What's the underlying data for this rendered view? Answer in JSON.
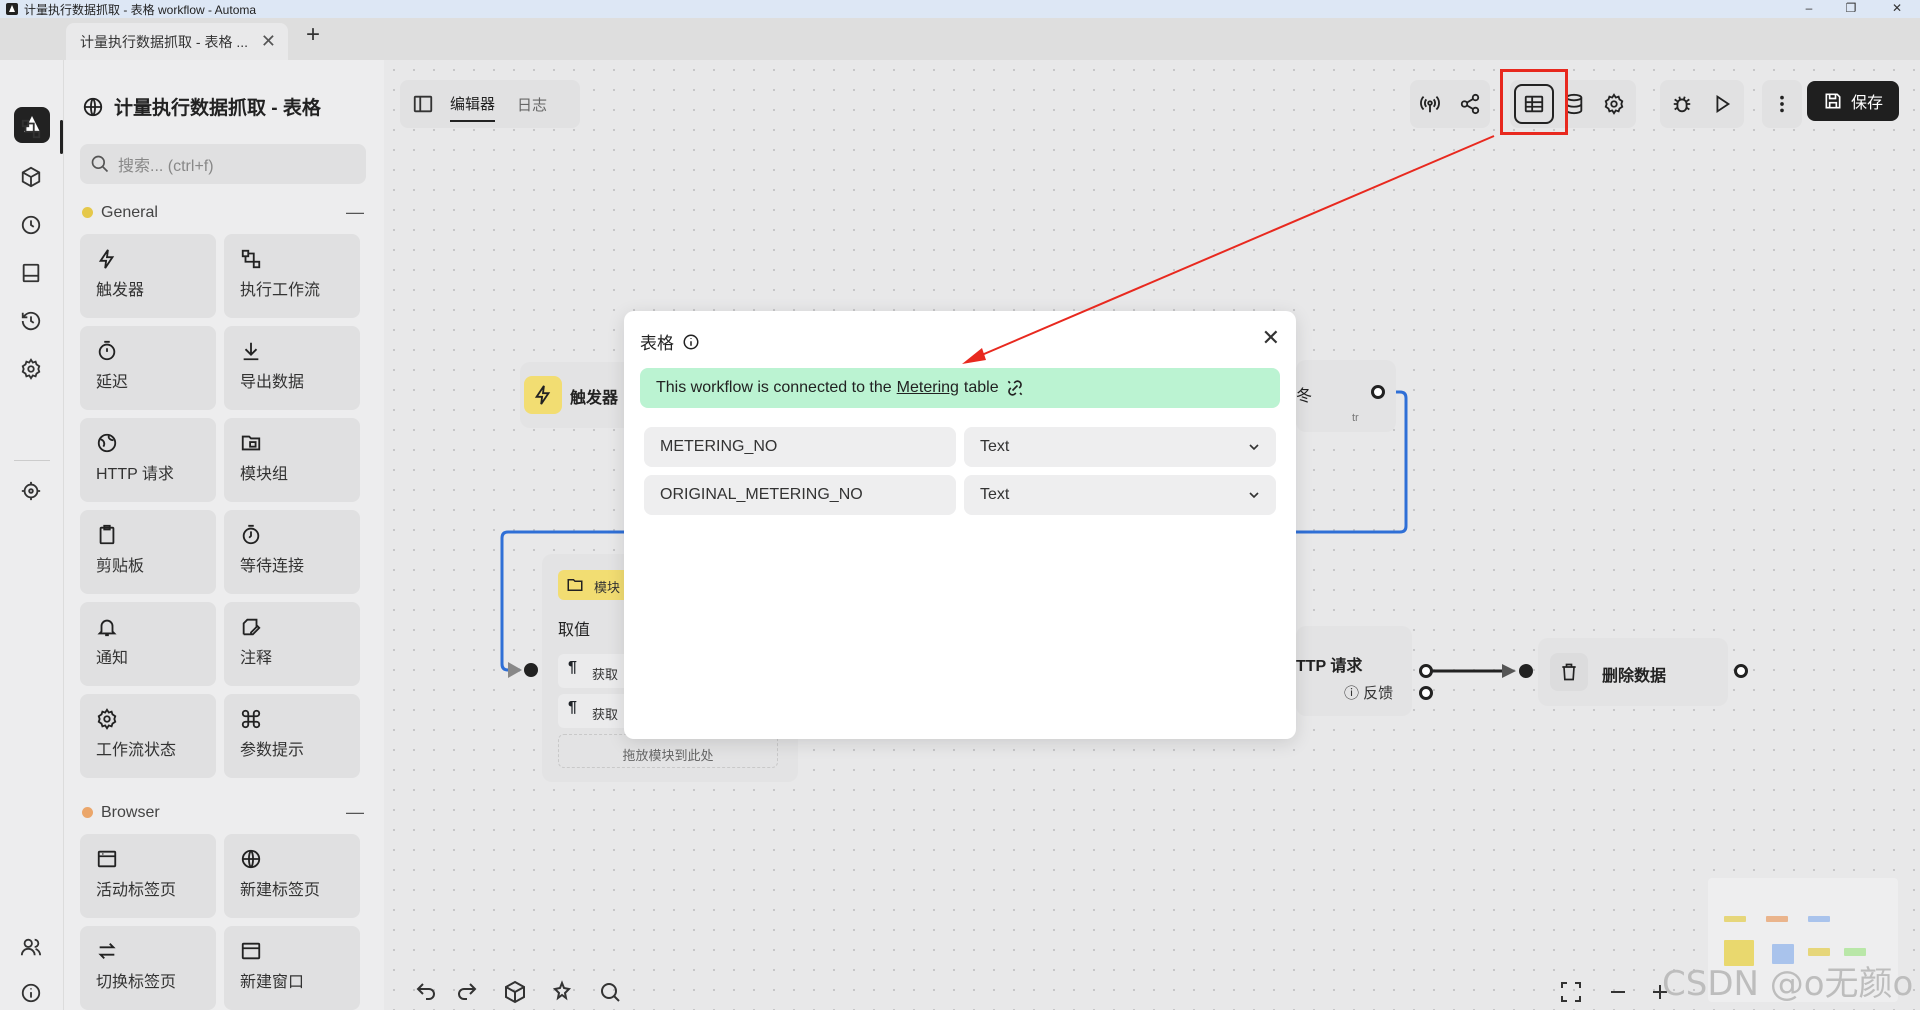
{
  "window": {
    "title": "计量执行数据抓取 - 表格 workflow - Automa",
    "minimize": "–",
    "maximize": "❐",
    "close": "✕"
  },
  "browser_tab": {
    "label": "计量执行数据抓取 - 表格 ...",
    "close": "✕",
    "new_tab": "+"
  },
  "panel": {
    "workflow_title": "计量执行数据抓取 - 表格",
    "search_placeholder": "搜索... (ctrl+f)",
    "groups": [
      {
        "name": "General",
        "color": "#e5c84a",
        "collapse": "—"
      },
      {
        "name": "Browser",
        "color": "#eba66a",
        "collapse": "—"
      }
    ],
    "blocks": [
      {
        "label": "触发器",
        "icon": "lightning-icon"
      },
      {
        "label": "执行工作流",
        "icon": "workflow-icon"
      },
      {
        "label": "延迟",
        "icon": "timer-icon"
      },
      {
        "label": "导出数据",
        "icon": "download-icon"
      },
      {
        "label": "HTTP 请求",
        "icon": "globe-icon"
      },
      {
        "label": "模块组",
        "icon": "folder-icon"
      },
      {
        "label": "剪贴板",
        "icon": "clipboard-icon"
      },
      {
        "label": "等待连接",
        "icon": "stopwatch-icon"
      },
      {
        "label": "通知",
        "icon": "bell-icon"
      },
      {
        "label": "注释",
        "icon": "note-icon"
      },
      {
        "label": "工作流状态",
        "icon": "gear-icon"
      },
      {
        "label": "参数提示",
        "icon": "command-icon"
      },
      {
        "label": "活动标签页",
        "icon": "window-icon"
      },
      {
        "label": "新建标签页",
        "icon": "globe-icon"
      },
      {
        "label": "切换标签页",
        "icon": "swap-icon"
      },
      {
        "label": "新建窗口",
        "icon": "window-icon"
      }
    ]
  },
  "editor": {
    "tabs": [
      {
        "label": "编辑器",
        "active": true
      },
      {
        "label": "日志",
        "active": false
      }
    ],
    "save_label": "保存"
  },
  "nodes": {
    "trigger": {
      "label": "触发器"
    },
    "group": {
      "badge": "模块",
      "title": "取值",
      "item_1": "获取",
      "item_2": "获取",
      "drop_hint": "拖放模块到此处"
    },
    "partial_right_label": "冬",
    "partial_small_tag": "tr",
    "http": {
      "label": "TTP 请求",
      "fallback": "反馈"
    },
    "delete": {
      "label": "删除数据"
    }
  },
  "modal": {
    "title": "表格",
    "close": "✕",
    "connected_prefix": "This workflow is connected to the",
    "connected_link": "Metering",
    "connected_suffix": "table",
    "columns": [
      {
        "name": "METERING_NO",
        "type": "Text"
      },
      {
        "name": "ORIGINAL_METERING_NO",
        "type": "Text"
      }
    ]
  },
  "watermark": "CSDN @o无颜o",
  "colors": {
    "annotation_red": "#e8291f",
    "connected_bg": "#bbf3d2",
    "edge_blue": "#2f6fd6",
    "trigger_yellow": "#f2dd72"
  }
}
